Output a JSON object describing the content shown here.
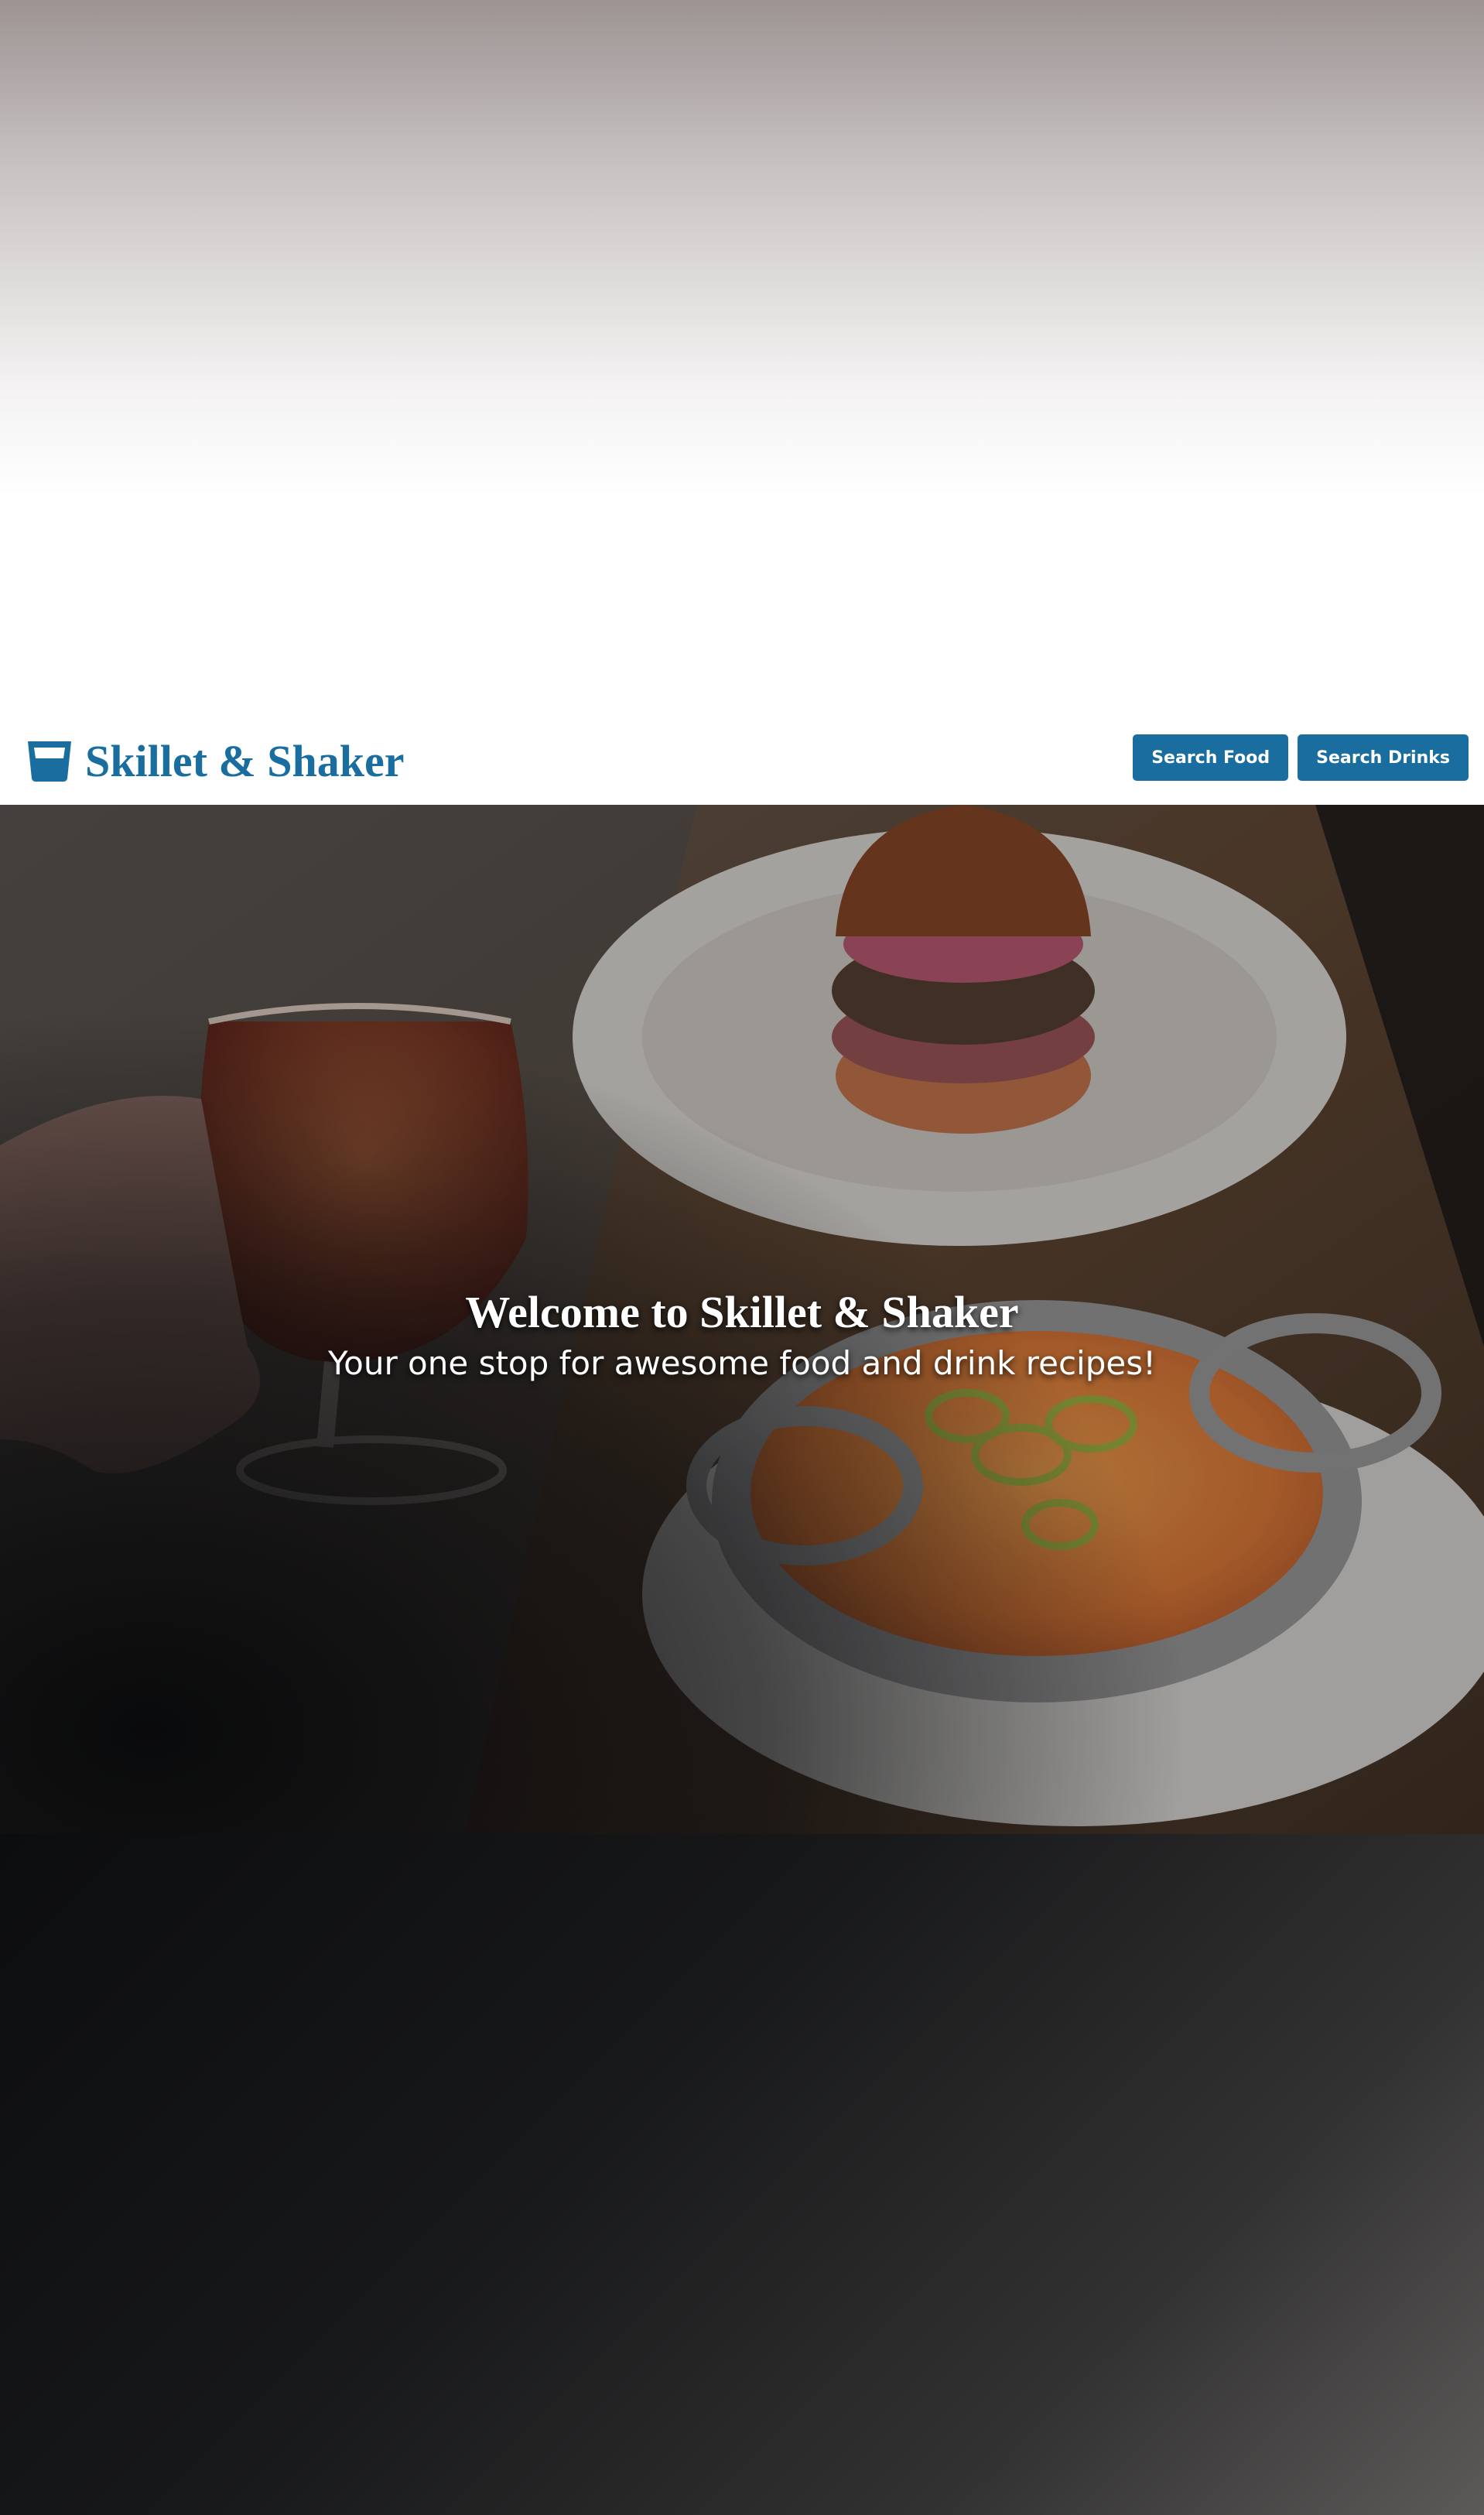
{
  "brand": {
    "name": "Skillet & Shaker",
    "logo_icon": "glass-icon",
    "color": "#1a6e9f"
  },
  "nav": {
    "search_food_label": "Search Food",
    "search_drinks_label": "Search Drinks"
  },
  "hero": {
    "title": "Welcome to Skillet & Shaker",
    "subtitle": "Your one stop for awesome food and drink recipes!",
    "image_subject": "whiskey glass, burger and skillet mac and cheese on a wooden table"
  },
  "colors": {
    "accent": "#1a6e9f",
    "button_text": "#ffffff",
    "hero_text": "#ffffff"
  }
}
